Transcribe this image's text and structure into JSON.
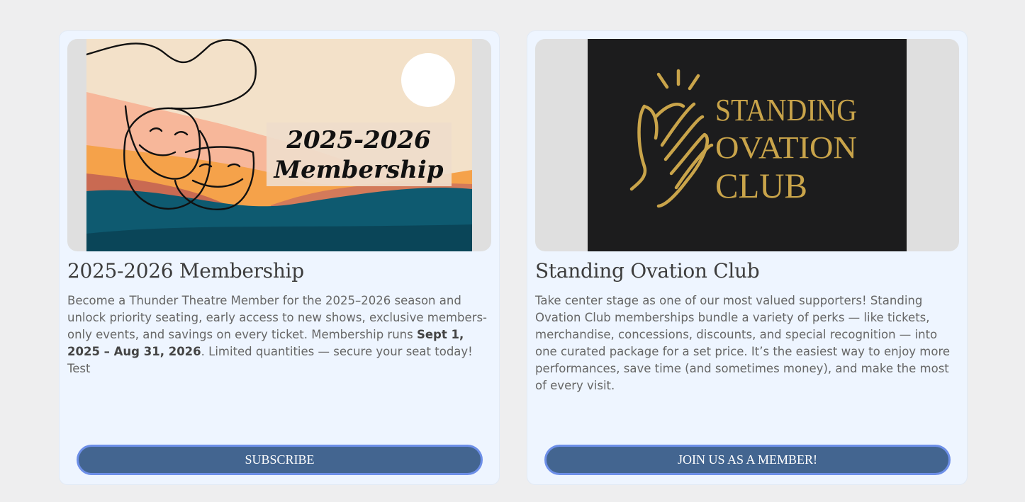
{
  "cards": [
    {
      "image": {
        "line1": "2025-2026",
        "line2": "Membership",
        "icon": "theatre-masks-icon"
      },
      "title": "2025-2026 Membership",
      "desc_pre": "Become a Thunder Theatre Member for the 2025–2026 season and unlock priority seating, early access to new shows, exclusive members-only events, and savings on every ticket. Membership runs ",
      "desc_bold": "Sept 1, 2025 – Aug 31, 2026",
      "desc_post": ". Limited quantities — secure your seat today! Test",
      "button_label": "SUBSCRIBE"
    },
    {
      "image": {
        "line1": "STANDING",
        "line2": "OVATION",
        "line3": "CLUB",
        "icon": "clapping-hands-icon"
      },
      "title": "Standing Ovation Club",
      "description": "Take center stage as one of our most valued supporters! Standing Ovation Club memberships bundle a variety of perks — like tickets, merchandise, concessions, discounts, and special recognition — into one curated package for a set price. It’s the easiest way to enjoy more performances, save time (and sometimes money), and make the most of every visit.",
      "button_label": "JOIN US AS A MEMBER!"
    }
  ],
  "colors": {
    "page_bg": "#eeeeef",
    "card_bg": "#eef5ff",
    "button_bg": "#436590",
    "button_border": "#6d8fe8",
    "ovation_gold": "#c9a44a"
  }
}
